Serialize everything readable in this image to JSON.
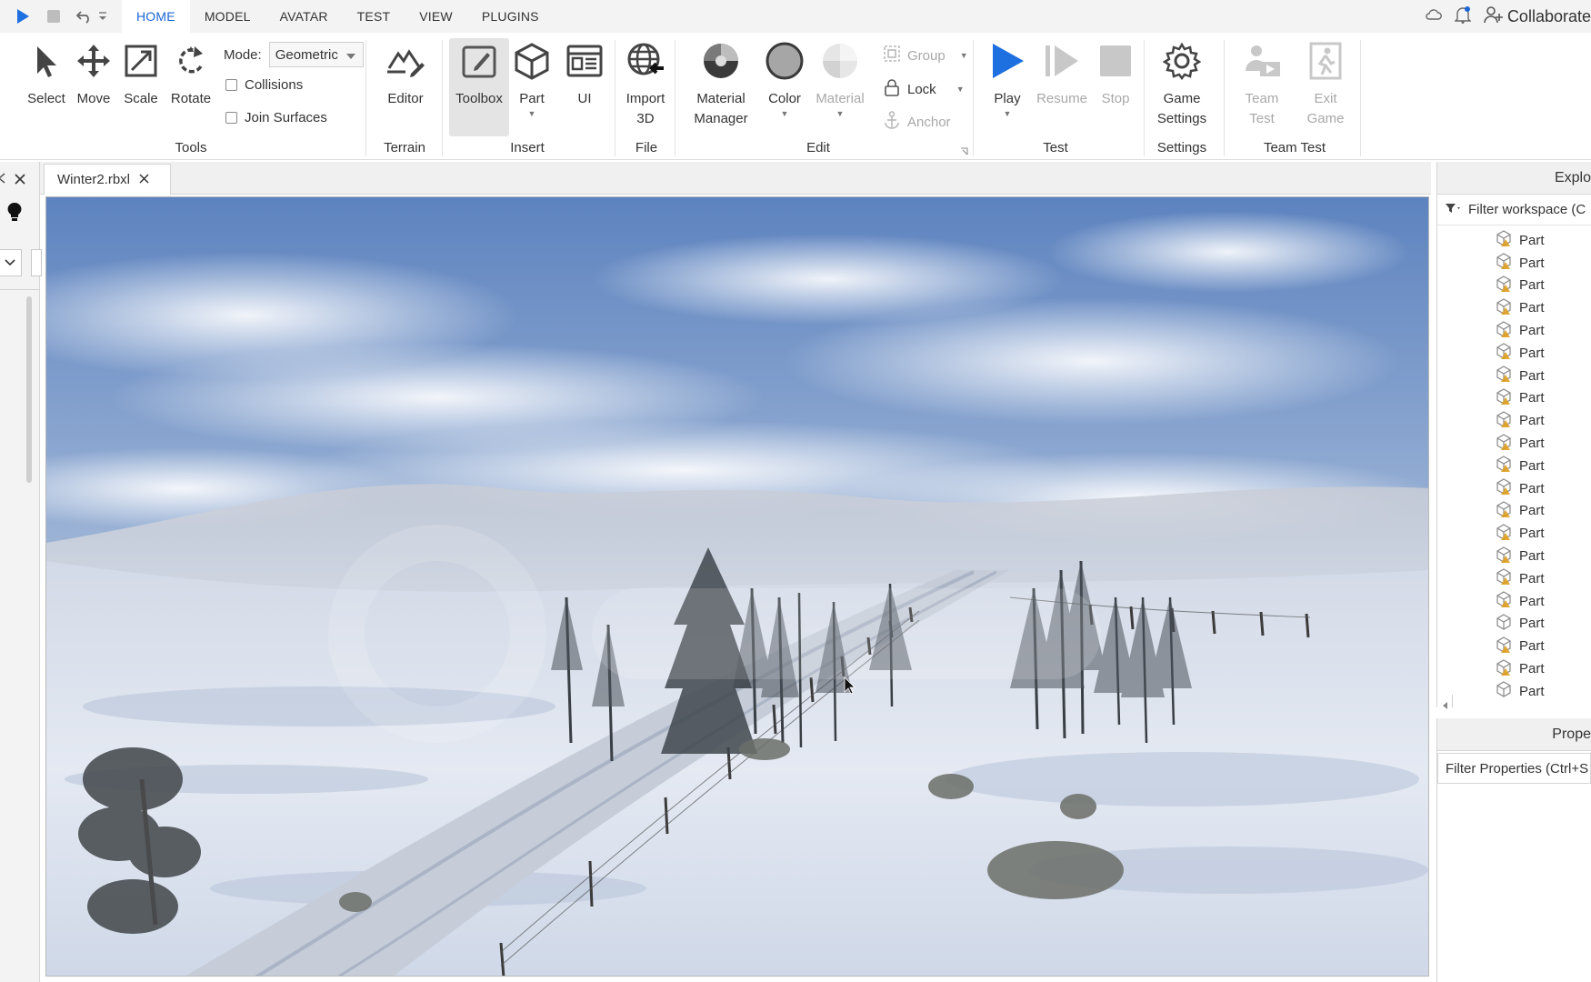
{
  "menubar": {
    "tabs": [
      {
        "label": "HOME",
        "active": true
      },
      {
        "label": "MODEL",
        "active": false
      },
      {
        "label": "AVATAR",
        "active": false
      },
      {
        "label": "TEST",
        "active": false
      },
      {
        "label": "VIEW",
        "active": false
      },
      {
        "label": "PLUGINS",
        "active": false
      }
    ],
    "collaborate_label": "Collaborate"
  },
  "ribbon": {
    "tools": {
      "select_label": "Select",
      "move_label": "Move",
      "scale_label": "Scale",
      "rotate_label": "Rotate",
      "mode_label": "Mode:",
      "mode_value": "Geometric",
      "collisions_label": "Collisions",
      "join_surfaces_label": "Join Surfaces",
      "group_label": "Tools"
    },
    "terrain": {
      "editor_label": "Editor",
      "group_label": "Terrain"
    },
    "insert": {
      "toolbox_label": "Toolbox",
      "part_label": "Part",
      "ui_label": "UI",
      "group_label": "Insert"
    },
    "file": {
      "import_line1": "Import",
      "import_line2": "3D",
      "group_label": "File"
    },
    "edit": {
      "material_manager_line1": "Material",
      "material_manager_line2": "Manager",
      "color_label": "Color",
      "material_label": "Material",
      "group_item_label": "Group",
      "lock_label": "Lock",
      "anchor_label": "Anchor",
      "group_label": "Edit"
    },
    "test": {
      "play_label": "Play",
      "resume_label": "Resume",
      "stop_label": "Stop",
      "group_label": "Test"
    },
    "settings": {
      "game_settings_line1": "Game",
      "game_settings_line2": "Settings",
      "group_label": "Settings"
    },
    "team_test": {
      "team_test_line1": "Team",
      "team_test_line2": "Test",
      "exit_game_line1": "Exit",
      "exit_game_line2": "Game",
      "group_label": "Team Test"
    }
  },
  "document": {
    "tab_label": "Winter2.rbxl"
  },
  "explorer": {
    "title": "Explo",
    "filter_placeholder": "Filter workspace (C",
    "items": [
      "Part",
      "Part",
      "Part",
      "Part",
      "Part",
      "Part",
      "Part",
      "Part",
      "Part",
      "Part",
      "Part",
      "Part",
      "Part",
      "Part",
      "Part",
      "Part",
      "Part",
      "Part",
      "Part",
      "Part",
      "Part"
    ]
  },
  "properties": {
    "title": "Prope",
    "filter_placeholder": "Filter Properties (Ctrl+S"
  },
  "colors": {
    "accent": "#1a66d6",
    "play": "#1e6fe0",
    "sky": "#7a9ccc",
    "snow": "#e6ebf3"
  }
}
